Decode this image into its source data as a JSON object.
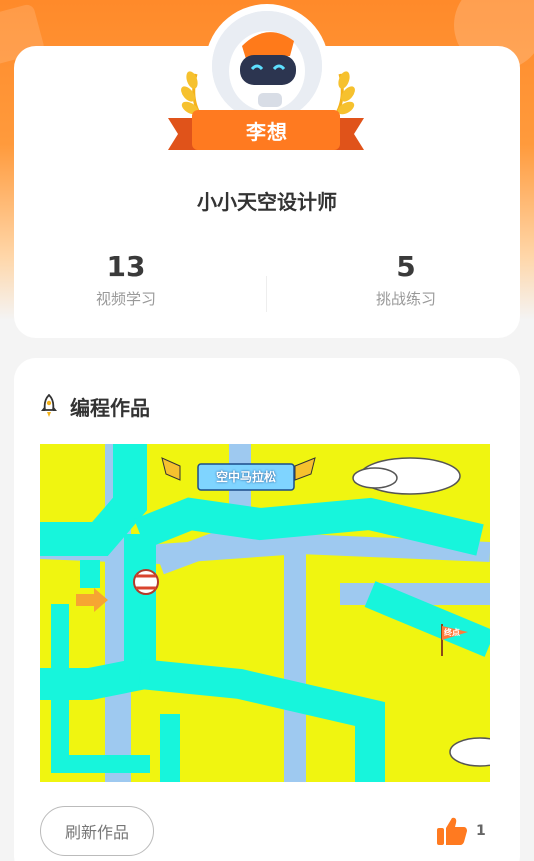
{
  "profile": {
    "name": "李想",
    "title": "小小天空设计师",
    "stats": [
      {
        "value": "13",
        "label": "视频学习"
      },
      {
        "value": "5",
        "label": "挑战练习"
      }
    ]
  },
  "works": {
    "section_title": "编程作品",
    "artwork": {
      "banner_text": "空中马拉松",
      "finish_flag_text": "终点"
    },
    "refresh_label": "刷新作品",
    "like_count": "1"
  },
  "icons": {
    "section": "rocket-icon",
    "like": "thumbs-up-icon"
  },
  "colors": {
    "accent": "#ff8a2a",
    "canvas_yellow": "#f0f510",
    "track_cyan": "#17f5dc",
    "river_blue": "#9ec9f0"
  }
}
